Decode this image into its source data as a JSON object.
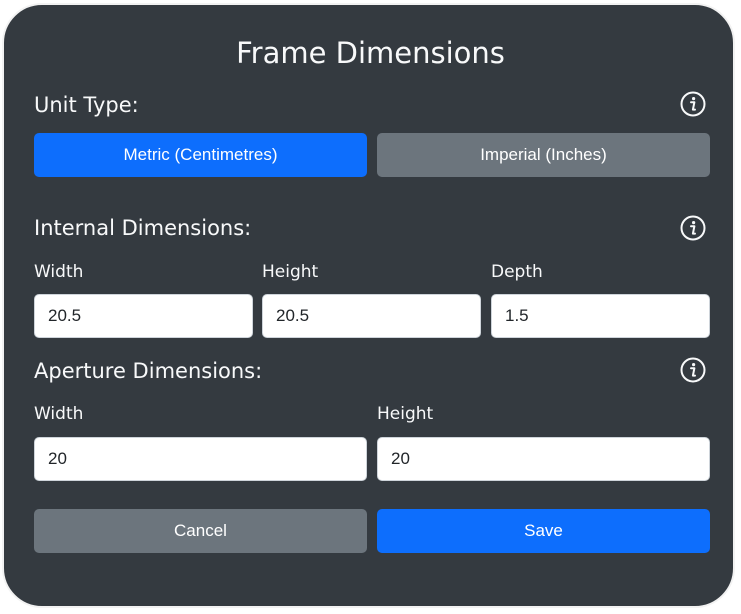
{
  "dialog": {
    "title": "Frame Dimensions"
  },
  "unit_type": {
    "label": "Unit Type:",
    "info_icon": "info-icon",
    "options": [
      {
        "label": "Metric (Centimetres)",
        "selected": true
      },
      {
        "label": "Imperial (Inches)",
        "selected": false
      }
    ]
  },
  "internal": {
    "label": "Internal Dimensions:",
    "info_icon": "info-icon",
    "fields": [
      {
        "label": "Width",
        "value": "20.5"
      },
      {
        "label": "Height",
        "value": "20.5"
      },
      {
        "label": "Depth",
        "value": "1.5"
      }
    ]
  },
  "aperture": {
    "label": "Aperture Dimensions:",
    "info_icon": "info-icon",
    "fields": [
      {
        "label": "Width",
        "value": "20"
      },
      {
        "label": "Height",
        "value": "20"
      }
    ]
  },
  "actions": {
    "cancel_label": "Cancel",
    "save_label": "Save"
  },
  "colors": {
    "background": "#343a40",
    "primary": "#0d6efd",
    "secondary": "#6c757d",
    "border": "#f2f2f2"
  }
}
